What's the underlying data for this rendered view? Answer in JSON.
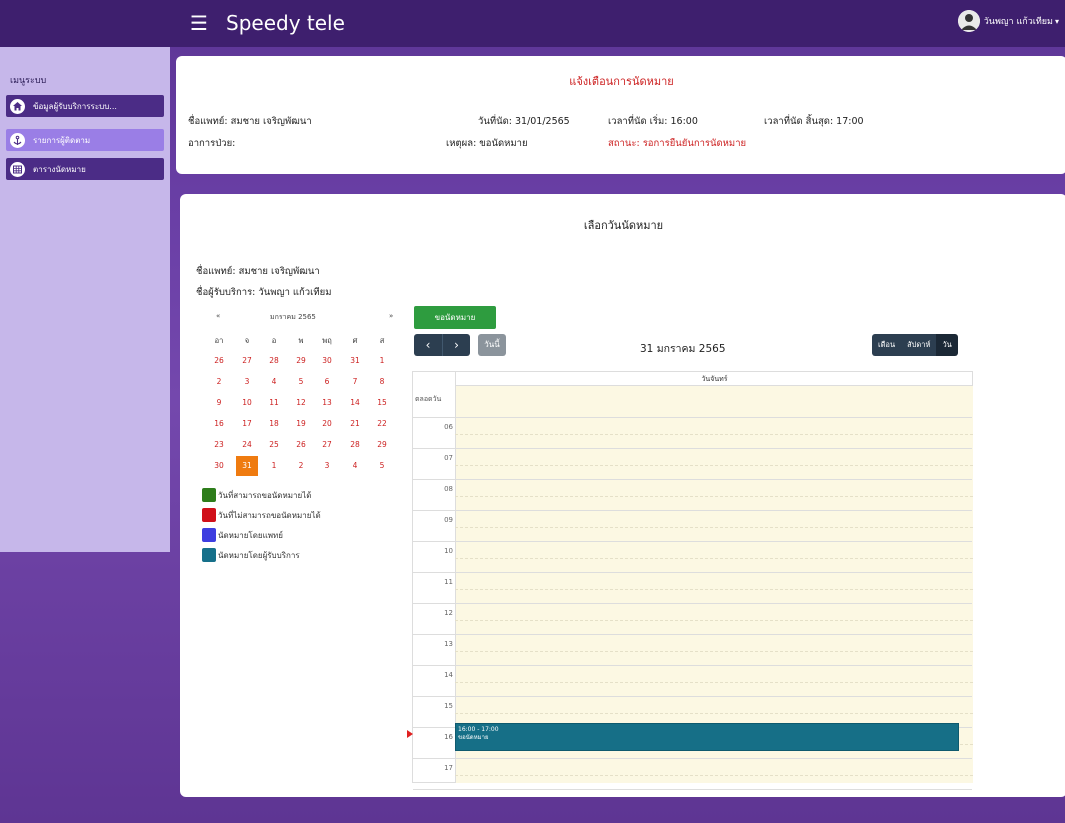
{
  "app": {
    "brand": "Speedy tele",
    "menu_icon": "☰",
    "user_name": "วันพญา แก้วเทียม",
    "user_caret": "▾"
  },
  "sidebar": {
    "title": "เมนูระบบ",
    "items": [
      {
        "label": "ข้อมูลผู้รับบริการระบบ...",
        "icon": "home-icon"
      },
      {
        "label": "รายการผู้ติดตาม",
        "icon": "anchor-icon"
      },
      {
        "label": "ตารางนัดหมาย",
        "icon": "grid-icon"
      }
    ]
  },
  "notify": {
    "title": "แจ้งเตือนการนัดหมาย",
    "doctor": "ชื่อแพทย์: สมชาย เจริญพัฒนา",
    "date": "วันที่นัด: 31/01/2565",
    "start": "เวลาที่นัด เริ่ม: 16:00",
    "end": "เวลาที่นัด สิ้นสุด: 17:00",
    "symptom": "อาการป่วย:",
    "reason": "เหตุผล: ขอนัดหมาย",
    "status": "สถานะ: รอการยืนยันการนัดหมาย"
  },
  "booking": {
    "title": "เลือกวันนัดหมาย",
    "doctor_line": "ชื่อแพทย์: สมชาย เจริญพัฒนา",
    "patient_line": "ชื่อผู้รับบริการ: วันพญา แก้วเทียม",
    "book_button": "ขอนัดหมาย"
  },
  "mini_calendar": {
    "prev": "«",
    "month": "มกราคม 2565",
    "next": "»",
    "weekdays": [
      "อา",
      "จ",
      "อ",
      "พ",
      "พฤ",
      "ศ",
      "ส"
    ],
    "weeks": [
      [
        "26",
        "27",
        "28",
        "29",
        "30",
        "31",
        "1"
      ],
      [
        "2",
        "3",
        "4",
        "5",
        "6",
        "7",
        "8"
      ],
      [
        "9",
        "10",
        "11",
        "12",
        "13",
        "14",
        "15"
      ],
      [
        "16",
        "17",
        "18",
        "19",
        "20",
        "21",
        "22"
      ],
      [
        "23",
        "24",
        "25",
        "26",
        "27",
        "28",
        "29"
      ],
      [
        "30",
        "31",
        "1",
        "2",
        "3",
        "4",
        "5"
      ]
    ],
    "today": "31"
  },
  "legend": [
    {
      "label": "วันที่สามารถขอนัดหมายได้",
      "color": "#2e7d1b"
    },
    {
      "label": "วันที่ไม่สามารถขอนัดหมายได้",
      "color": "#d0101a"
    },
    {
      "label": "นัดหมายโดยแพทย์",
      "color": "#3e3ee0"
    },
    {
      "label": "นัดหมายโดยผู้รับบริการ",
      "color": "#16708a"
    }
  ],
  "main_calendar": {
    "prev": "‹",
    "next": "›",
    "today_button": "วันนี้",
    "date_title": "31 มกราคม 2565",
    "views": [
      "เดือน",
      "สัปดาห์",
      "วัน"
    ],
    "active_view": "วัน",
    "day_header": "วันจันทร์",
    "allday_label": "ตลอดวัน",
    "hours": [
      "06",
      "07",
      "08",
      "09",
      "10",
      "11",
      "12",
      "13",
      "14",
      "15",
      "16",
      "17"
    ],
    "event_time": "16:00 - 17:00",
    "event_title": "ขอนัดหมาย"
  },
  "colors": {
    "navbar": "#3e1f6e",
    "sidebar": "#c6b7ea",
    "accent_red": "#cc1f1f",
    "book_green": "#2e9c3f",
    "today_orange": "#ef7b10",
    "slot_bg": "#fcf8e3",
    "event": "#166f87"
  }
}
